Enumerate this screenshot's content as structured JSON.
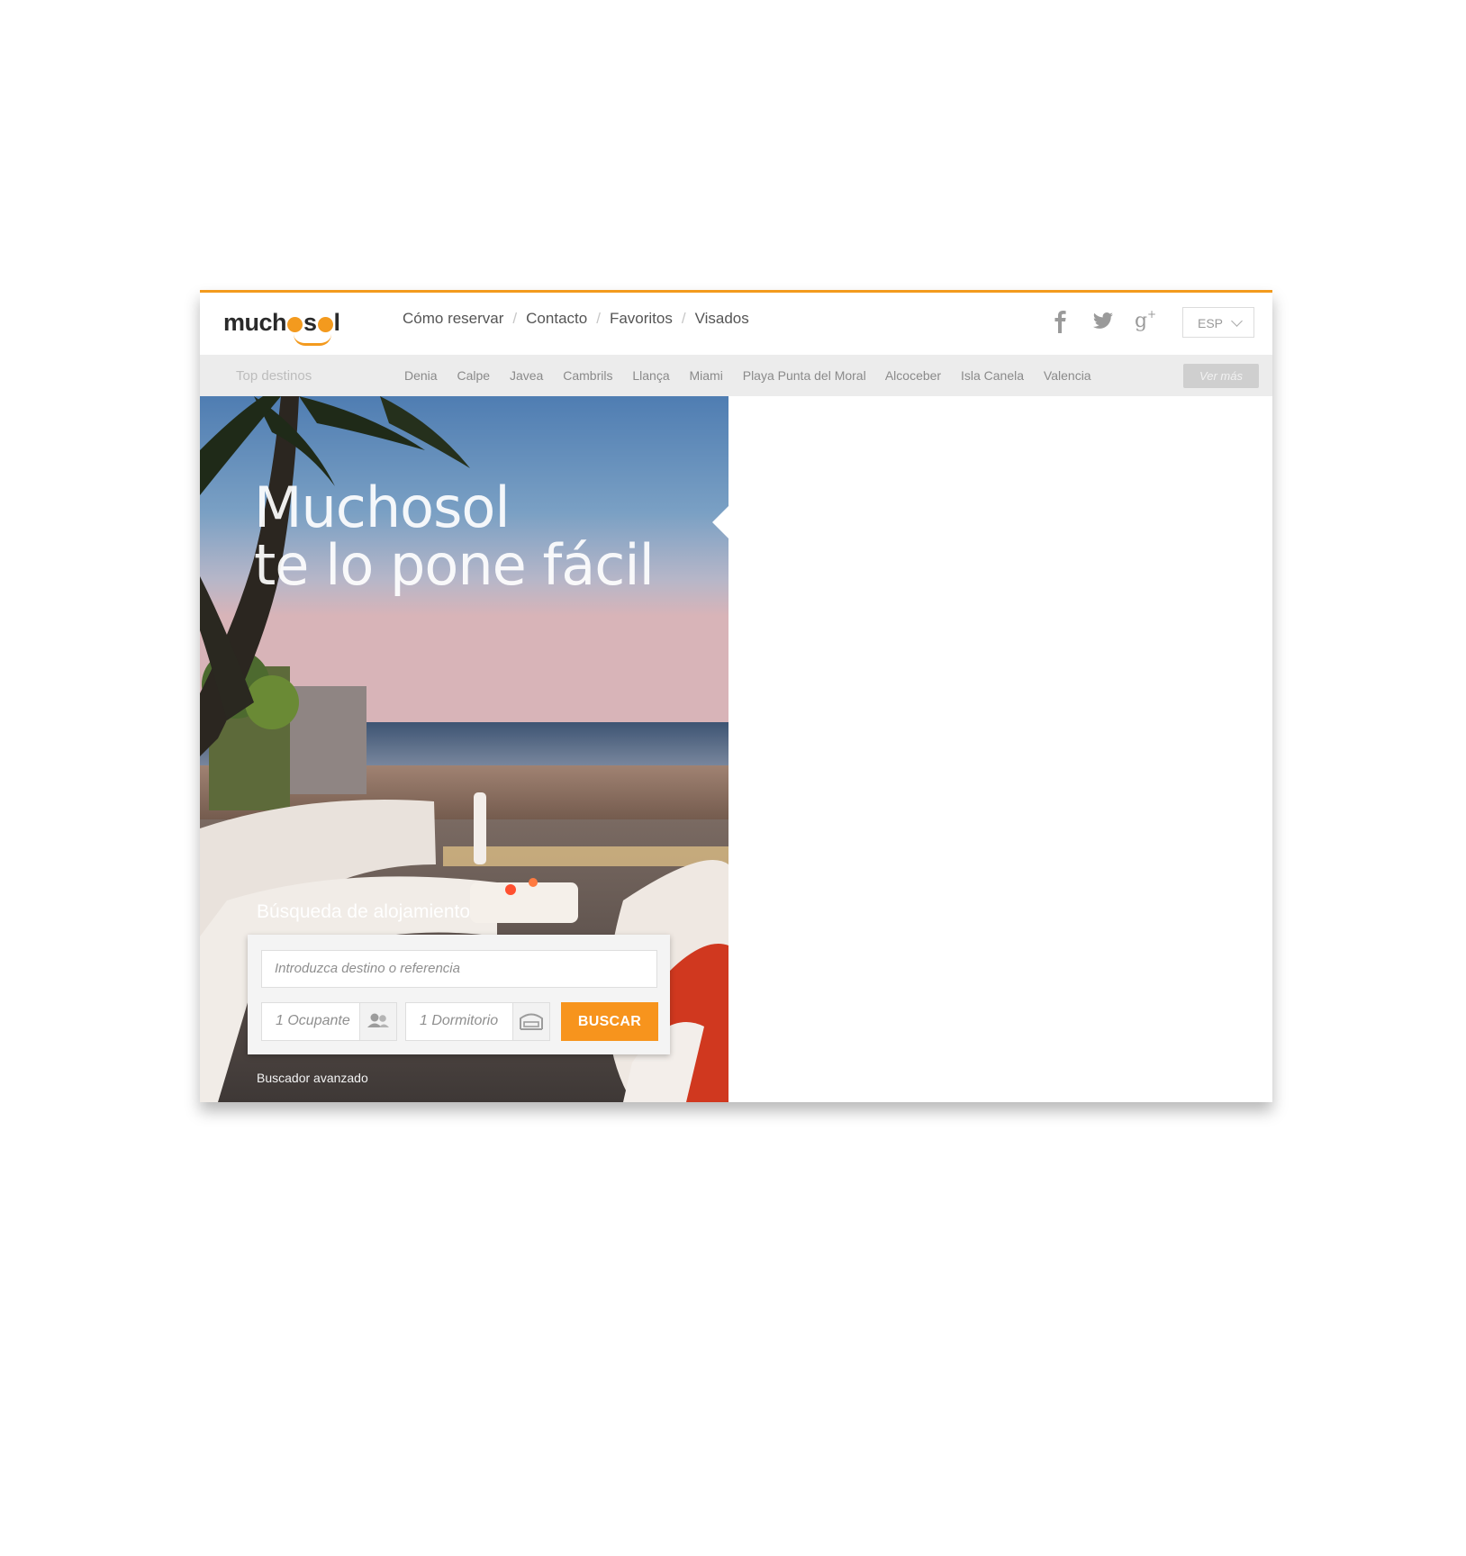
{
  "header": {
    "logo_text_before": "much",
    "logo_text_after": "s",
    "logo_text_end": "l",
    "nav": [
      "Cómo reservar",
      "Contacto",
      "Favoritos",
      "Visados"
    ],
    "social_icons": [
      "facebook-icon",
      "twitter-icon",
      "google-plus-icon"
    ],
    "language": "ESP"
  },
  "top_destinations": {
    "label": "Top destinos",
    "items": [
      "Denia",
      "Calpe",
      "Javea",
      "Cambrils",
      "Llança",
      "Miami",
      "Playa Punta del Moral",
      "Alcoceber",
      "Isla Canela",
      "Valencia"
    ],
    "more_label": "Ver más"
  },
  "hero": {
    "headline_line1": "Muchosol",
    "headline_line2": "te lo pone fácil"
  },
  "search": {
    "title": "Búsqueda de alojamiento",
    "destination_placeholder": "Introduzca destino o referencia",
    "occupants": "1 Ocupante",
    "bedrooms": "1 Dormitorio",
    "submit_label": "BUSCAR",
    "advanced_link": "Buscador avanzado"
  },
  "colors": {
    "accent": "#f7941d",
    "top_border": "#f39a1e",
    "subbar_bg": "#ececec"
  }
}
